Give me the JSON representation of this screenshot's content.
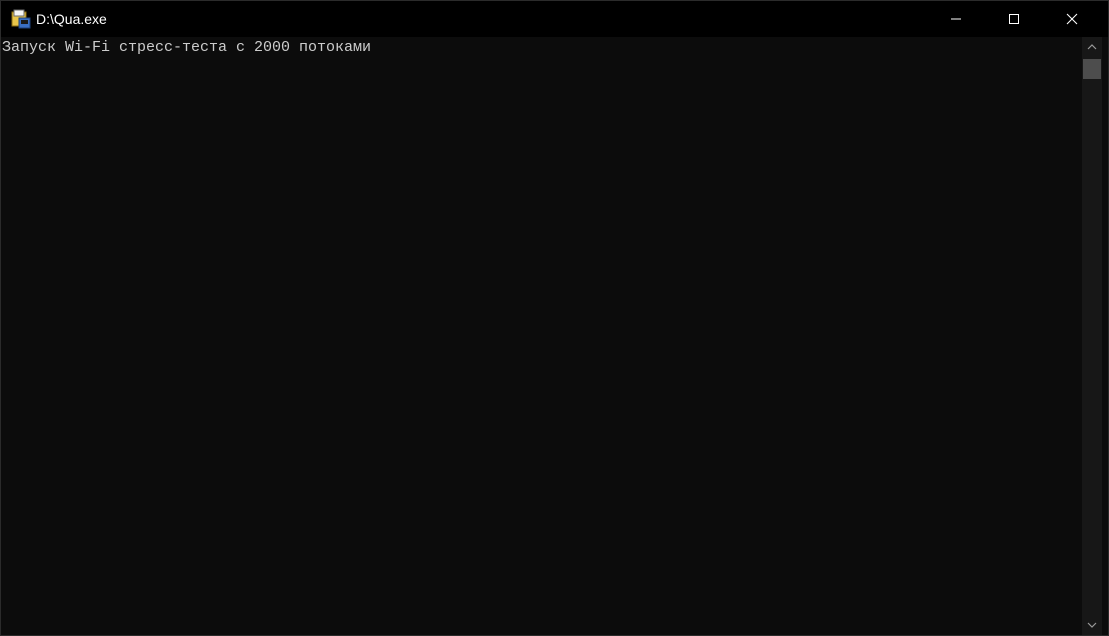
{
  "window": {
    "title": "D:\\Qua.exe",
    "app_icon": "console-app-icon"
  },
  "titlebar_buttons": {
    "minimize_icon": "minimize-icon",
    "maximize_icon": "maximize-icon",
    "close_icon": "close-icon"
  },
  "console": {
    "lines": [
      "Запуск Wi-Fi стресс-теста с 2000 потоками"
    ]
  },
  "scrollbar": {
    "up_icon": "scroll-up-arrow-icon",
    "down_icon": "scroll-down-arrow-icon",
    "position_fraction": 0.0
  },
  "colors": {
    "titlebar_bg": "#000000",
    "console_bg": "#0c0c0c",
    "console_text": "#cccccc",
    "title_text": "#ffffff",
    "scrollbar_track": "#171717",
    "scrollbar_thumb": "#4d4d4d"
  }
}
